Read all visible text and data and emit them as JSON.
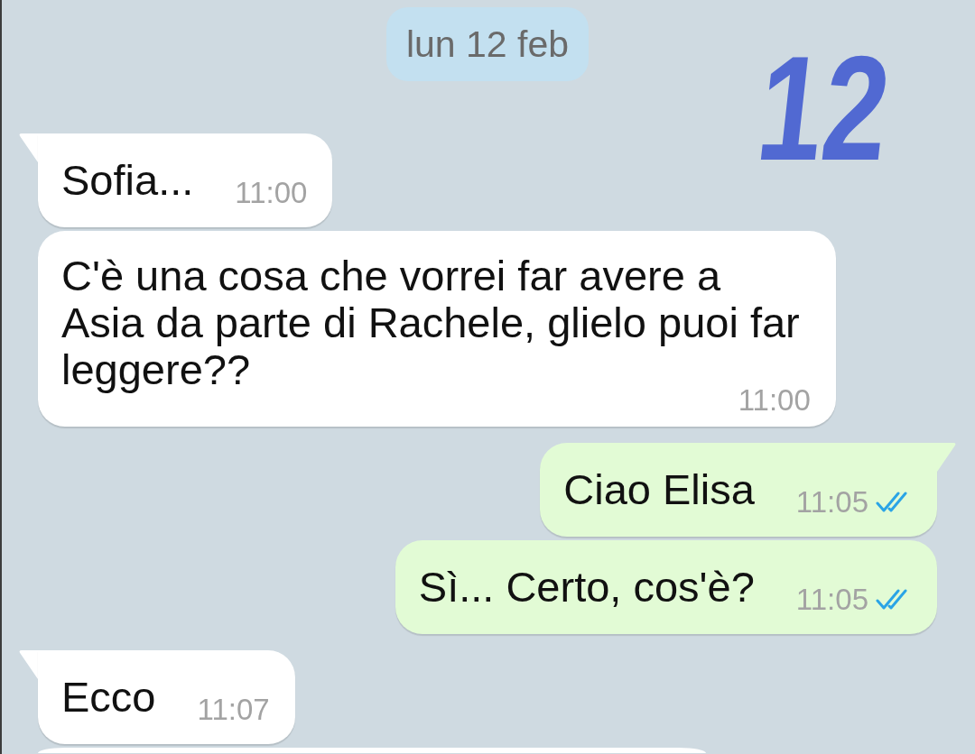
{
  "date_label": "lun 12 feb",
  "messages": [
    {
      "kind": "incoming",
      "lines": [
        "Sofia..."
      ],
      "time": "11:00"
    },
    {
      "kind": "incoming",
      "lines": [
        "C'è una cosa che vorrei far avere a",
        "Asia da parte di Rachele, glielo puoi far",
        "leggere??"
      ],
      "time": "11:00"
    },
    {
      "kind": "outgoing",
      "lines": [
        "Ciao Elisa"
      ],
      "time": "11:05",
      "read": true
    },
    {
      "kind": "outgoing",
      "lines": [
        "Sì... Certo, cos'è?"
      ],
      "time": "11:05",
      "read": true
    },
    {
      "kind": "incoming",
      "lines": [
        "Ecco"
      ],
      "time": "11:07"
    },
    {
      "kind": "incoming"
    }
  ],
  "annotation": {
    "text": "12"
  }
}
